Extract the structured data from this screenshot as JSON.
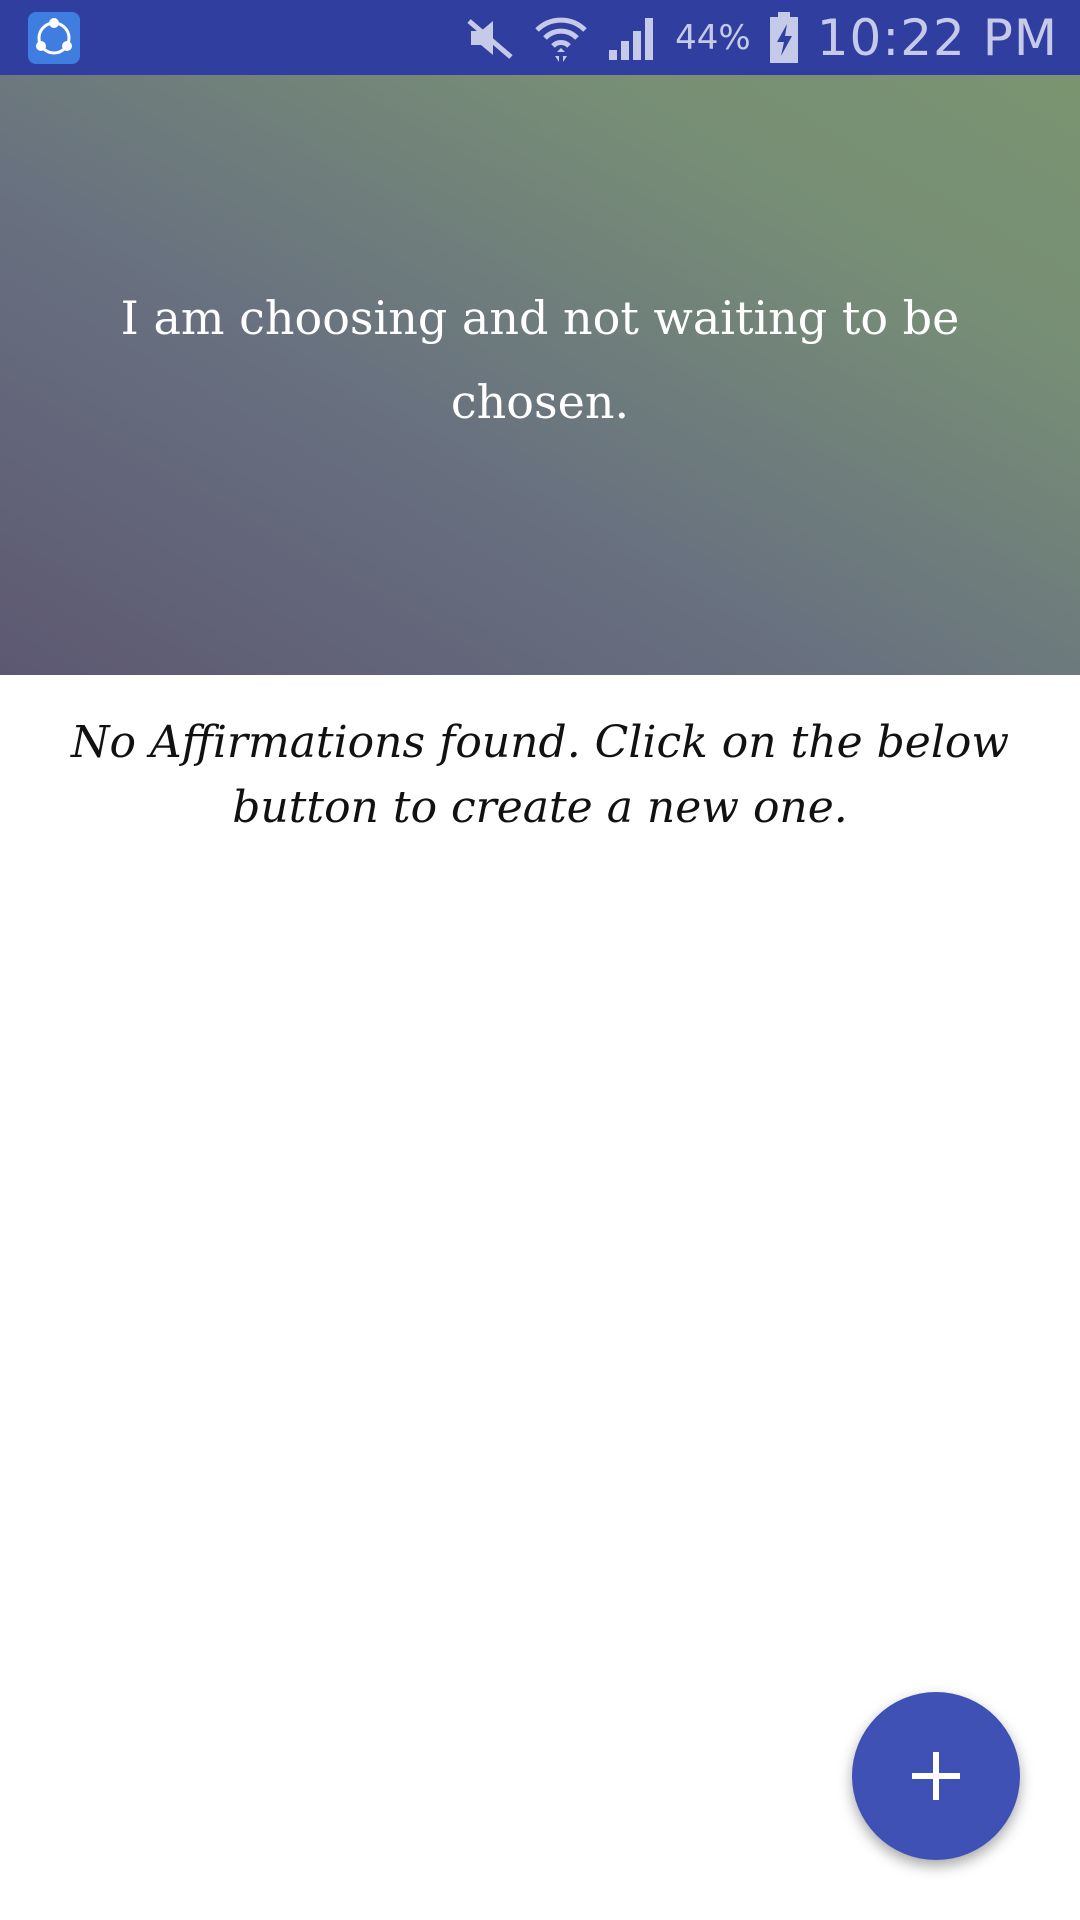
{
  "status_bar": {
    "battery_percent": "44%",
    "time": "10:22 PM",
    "icons": [
      "shareit-app-icon",
      "mute-icon",
      "wifi-icon",
      "signal-icon",
      "battery-charging-icon"
    ]
  },
  "hero": {
    "affirmation": "I am choosing and not waiting to be chosen."
  },
  "main": {
    "empty_message": "No Affirmations found. Click on the below button to create a new one."
  },
  "fab": {
    "icon": "plus-icon"
  },
  "colors": {
    "status_bar": "#303F9F",
    "accent": "#3F51B5",
    "hero_gradient_start": "#5d5872",
    "hero_gradient_end": "#7a9470"
  }
}
